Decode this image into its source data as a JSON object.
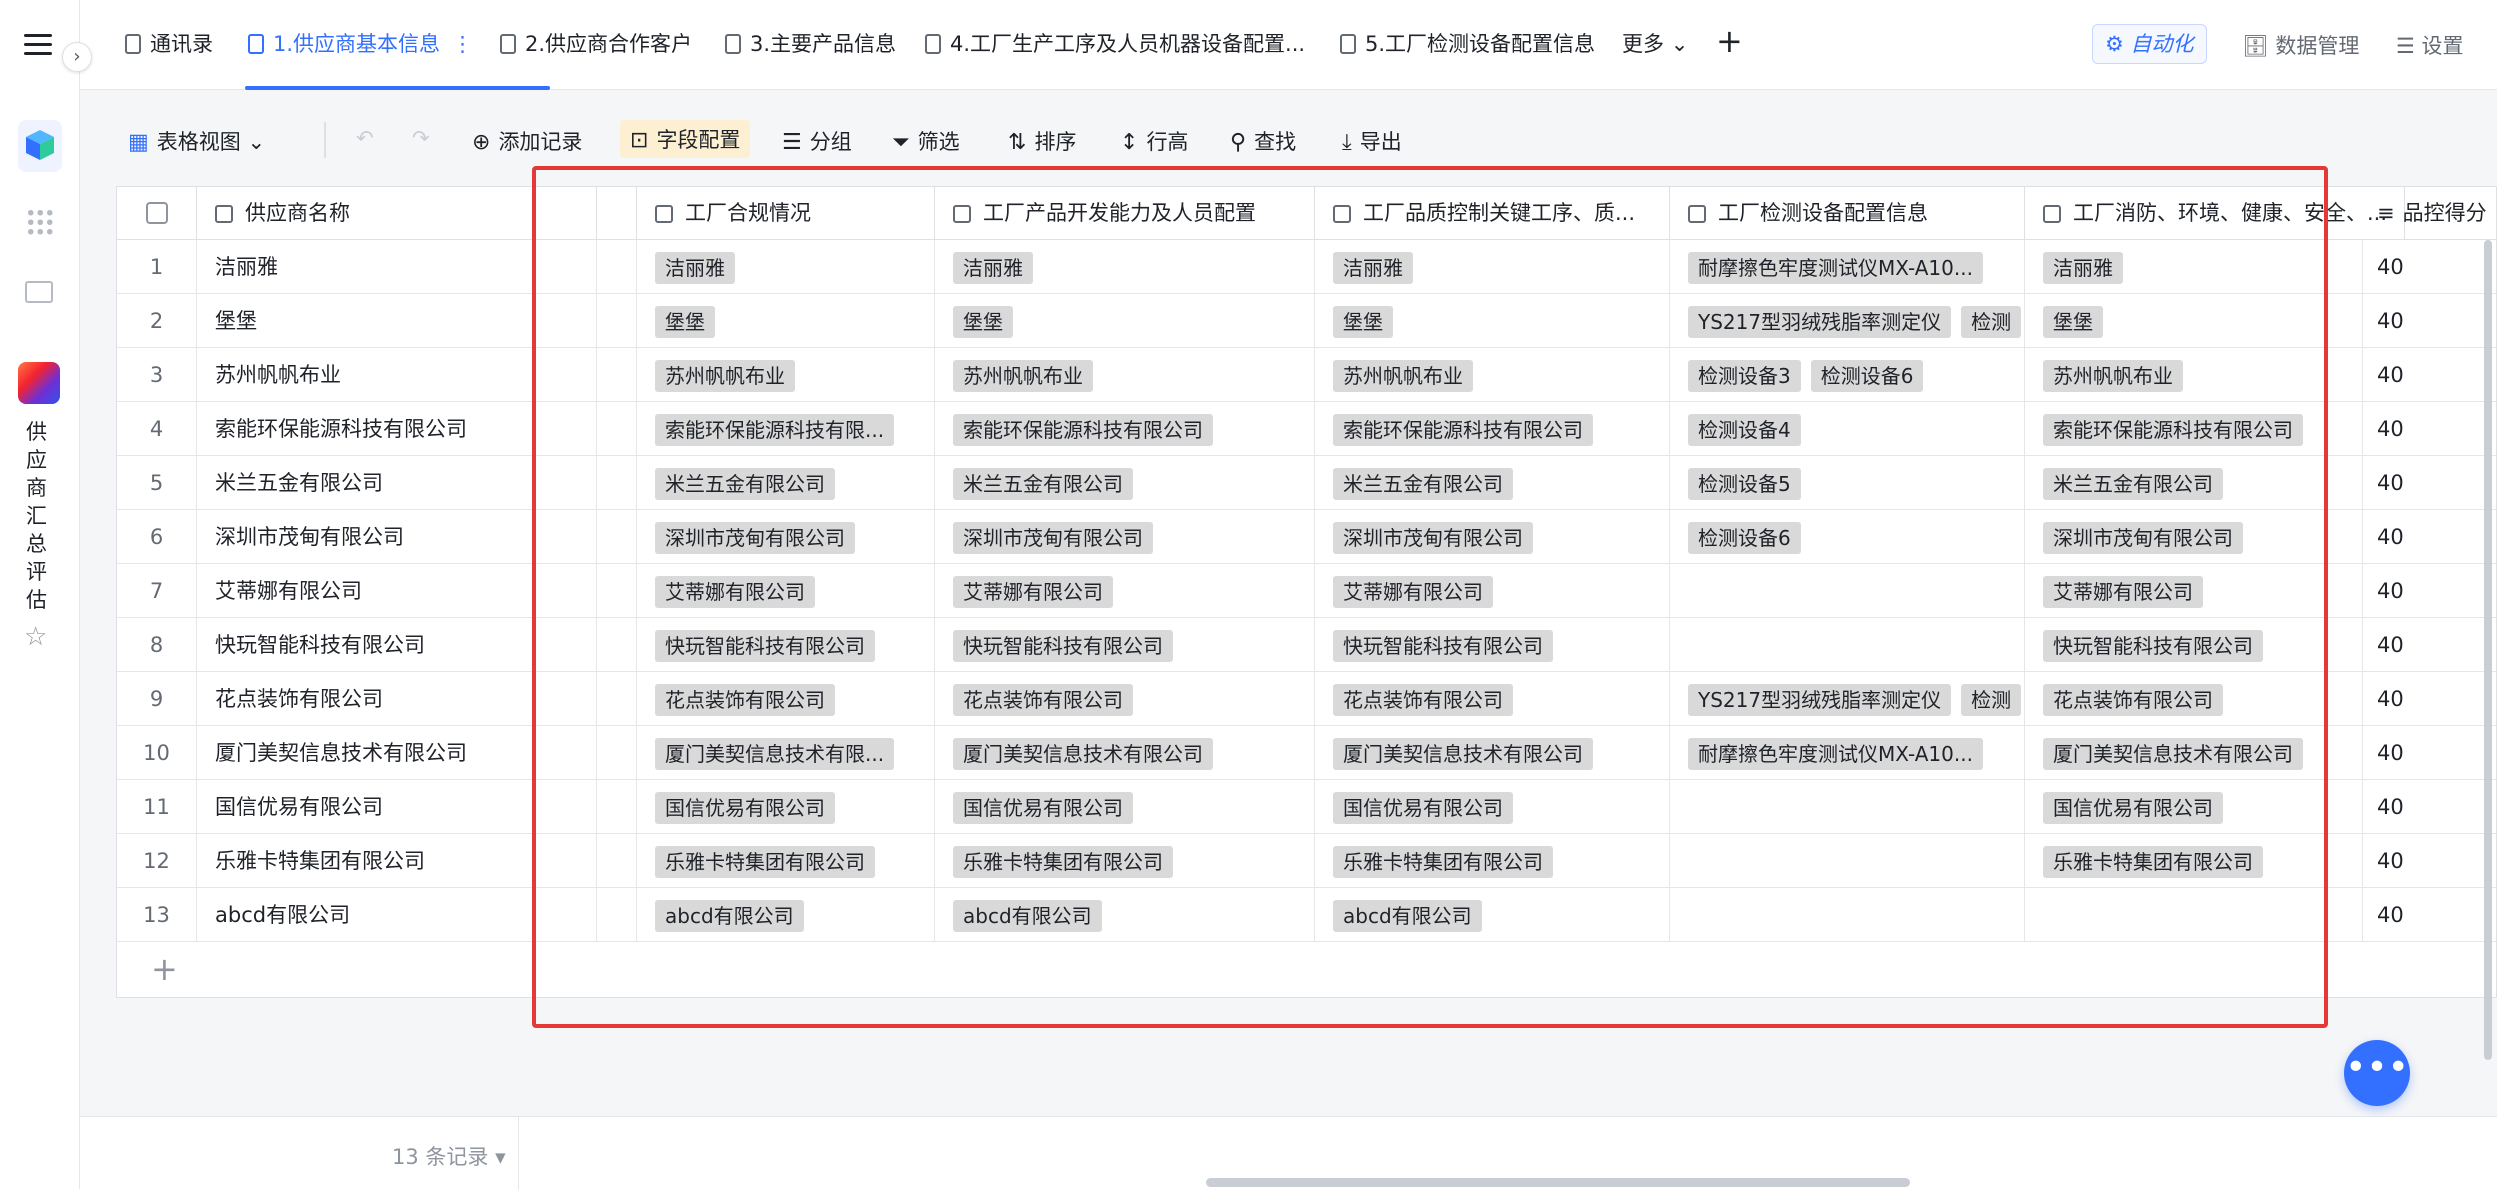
{
  "sidebar": {
    "app_title_chars": [
      "供",
      "应",
      "商",
      "汇",
      "总",
      "评",
      "估"
    ]
  },
  "tabs": [
    {
      "label": "通讯录"
    },
    {
      "label": "1.供应商基本信息"
    },
    {
      "label": "2.供应商合作客户"
    },
    {
      "label": "3.主要产品信息"
    },
    {
      "label": "4.工厂生产工序及人员机器设备配置..."
    },
    {
      "label": "5.工厂检测设备配置信息"
    }
  ],
  "tabs_more": "更多",
  "tabs_active_dots": "⋮",
  "header_right": {
    "automation": "自动化",
    "data_management": "数据管理",
    "settings": "设置"
  },
  "toolbar": {
    "view": "表格视图",
    "add_record": "添加记录",
    "field_config": "字段配置",
    "group": "分组",
    "filter": "筛选",
    "sort": "排序",
    "row_height": "行高",
    "find": "查找",
    "export": "导出"
  },
  "columns": {
    "name": "供应商名称",
    "c1": "工厂合规情况",
    "c2": "工厂产品开发能力及人员配置",
    "c3": "工厂品质控制关键工序、质...",
    "c4": "工厂检测设备配置信息",
    "c5": "工厂消防、环境、健康、安全、...",
    "c6": "品控得分"
  },
  "rows": [
    {
      "n": "1",
      "name": "洁丽雅",
      "c1": "洁丽雅",
      "c2": "洁丽雅",
      "c3": "洁丽雅",
      "c4": [
        "耐摩擦色牢度测试仪MX-A10..."
      ],
      "c5": "洁丽雅",
      "score": "40"
    },
    {
      "n": "2",
      "name": "堡堡",
      "c1": "堡堡",
      "c2": "堡堡",
      "c3": "堡堡",
      "c4": [
        "YS217型羽绒残脂率测定仪",
        "检测"
      ],
      "c5": "堡堡",
      "score": "40"
    },
    {
      "n": "3",
      "name": "苏州帆帆布业",
      "c1": "苏州帆帆布业",
      "c2": "苏州帆帆布业",
      "c3": "苏州帆帆布业",
      "c4": [
        "检测设备3",
        "检测设备6"
      ],
      "c5": "苏州帆帆布业",
      "score": "40"
    },
    {
      "n": "4",
      "name": "索能环保能源科技有限公司",
      "c1": "索能环保能源科技有限...",
      "c2": "索能环保能源科技有限公司",
      "c3": "索能环保能源科技有限公司",
      "c4": [
        "检测设备4"
      ],
      "c5": "索能环保能源科技有限公司",
      "score": "40"
    },
    {
      "n": "5",
      "name": "米兰五金有限公司",
      "c1": "米兰五金有限公司",
      "c2": "米兰五金有限公司",
      "c3": "米兰五金有限公司",
      "c4": [
        "检测设备5"
      ],
      "c5": "米兰五金有限公司",
      "score": "40"
    },
    {
      "n": "6",
      "name": "深圳市茂甸有限公司",
      "c1": "深圳市茂甸有限公司",
      "c2": "深圳市茂甸有限公司",
      "c3": "深圳市茂甸有限公司",
      "c4": [
        "检测设备6"
      ],
      "c5": "深圳市茂甸有限公司",
      "score": "40"
    },
    {
      "n": "7",
      "name": "艾蒂娜有限公司",
      "c1": "艾蒂娜有限公司",
      "c2": "艾蒂娜有限公司",
      "c3": "艾蒂娜有限公司",
      "c4": [],
      "c5": "艾蒂娜有限公司",
      "score": "40"
    },
    {
      "n": "8",
      "name": "快玩智能科技有限公司",
      "c1": "快玩智能科技有限公司",
      "c2": "快玩智能科技有限公司",
      "c3": "快玩智能科技有限公司",
      "c4": [],
      "c5": "快玩智能科技有限公司",
      "score": "40"
    },
    {
      "n": "9",
      "name": "花点装饰有限公司",
      "c1": "花点装饰有限公司",
      "c2": "花点装饰有限公司",
      "c3": "花点装饰有限公司",
      "c4": [
        "YS217型羽绒残脂率测定仪",
        "检测"
      ],
      "c5": "花点装饰有限公司",
      "score": "40"
    },
    {
      "n": "10",
      "name": "厦门美契信息技术有限公司",
      "c1": "厦门美契信息技术有限...",
      "c2": "厦门美契信息技术有限公司",
      "c3": "厦门美契信息技术有限公司",
      "c4": [
        "耐摩擦色牢度测试仪MX-A10..."
      ],
      "c5": "厦门美契信息技术有限公司",
      "score": "40"
    },
    {
      "n": "11",
      "name": "国信优易有限公司",
      "c1": "国信优易有限公司",
      "c2": "国信优易有限公司",
      "c3": "国信优易有限公司",
      "c4": [],
      "c5": "国信优易有限公司",
      "score": "40"
    },
    {
      "n": "12",
      "name": "乐雅卡特集团有限公司",
      "c1": "乐雅卡特集团有限公司",
      "c2": "乐雅卡特集团有限公司",
      "c3": "乐雅卡特集团有限公司",
      "c4": [],
      "c5": "乐雅卡特集团有限公司",
      "score": "40"
    },
    {
      "n": "13",
      "name": "abcd有限公司",
      "c1": "abcd有限公司",
      "c2": "abcd有限公司",
      "c3": "abcd有限公司",
      "c4": [],
      "c5": "",
      "score": "40"
    }
  ],
  "footer": {
    "record_count": "13 条记录"
  },
  "colors": {
    "accent": "#3370ff",
    "highlight_box": "#e53935",
    "tag_bg": "#d9d9d9"
  }
}
